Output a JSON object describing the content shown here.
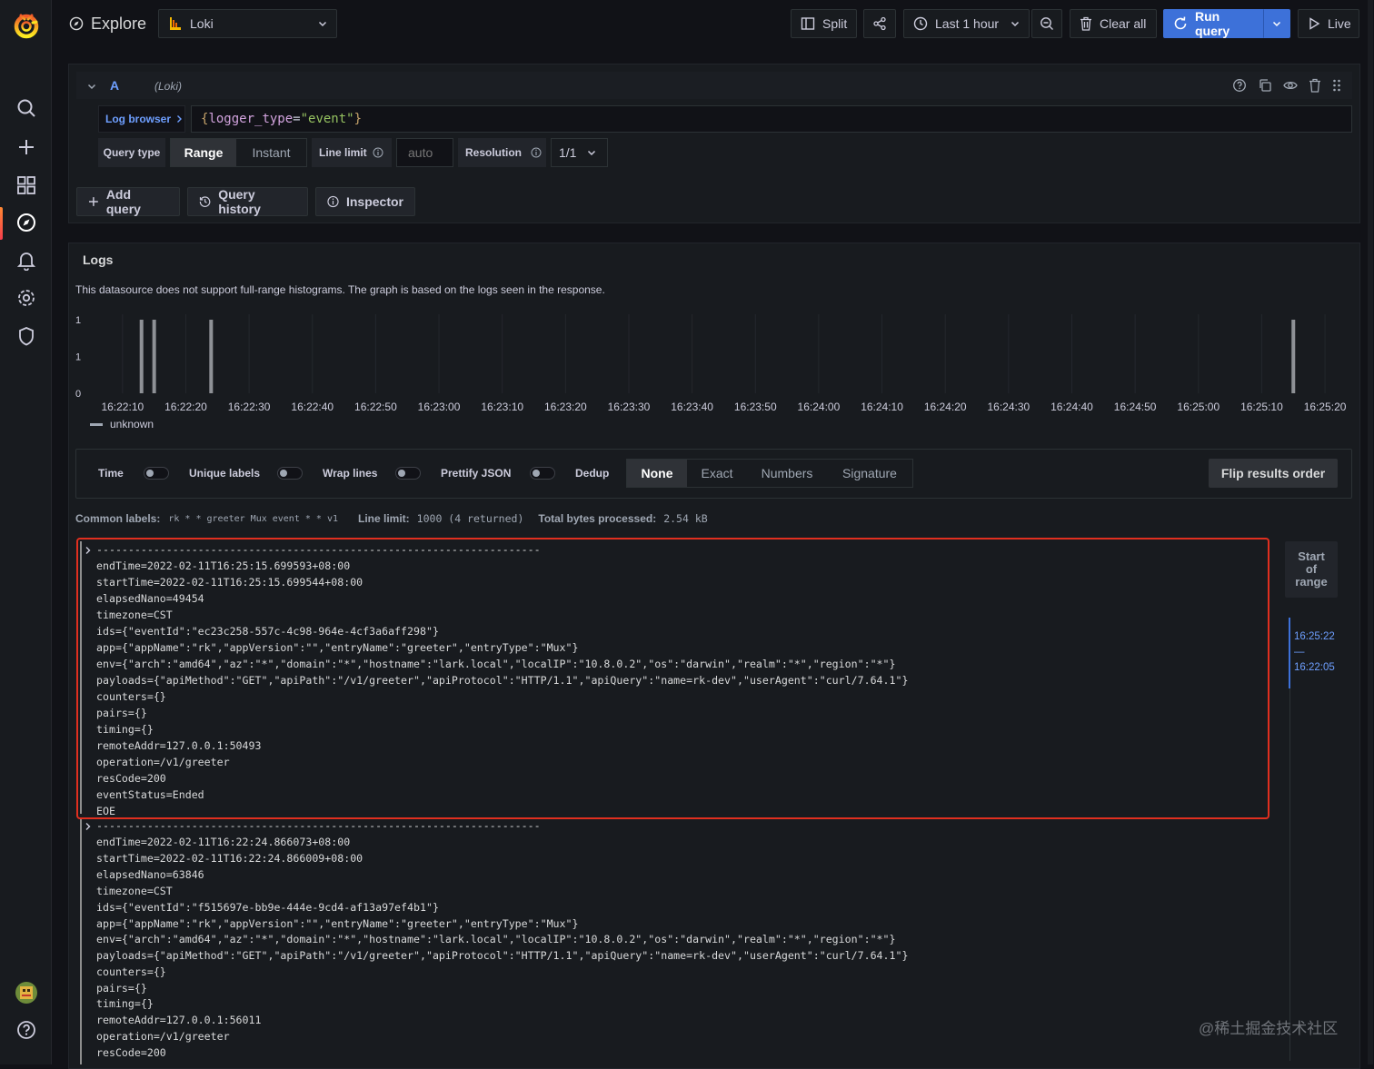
{
  "app": {
    "title": "Explore"
  },
  "datasource": {
    "name": "Loki"
  },
  "toolbar": {
    "split": "Split",
    "time_range": "Last 1 hour",
    "clear_all": "Clear all",
    "run_query": "Run query",
    "live": "Live"
  },
  "query": {
    "ref_id": "A",
    "datasource_label": "(Loki)",
    "log_browser": "Log browser",
    "expr": {
      "open": "{",
      "key": "logger_type",
      "eq": "=",
      "value": "\"event\"",
      "close": "}"
    },
    "query_type_label": "Query type",
    "types": [
      "Range",
      "Instant"
    ],
    "selected_type": "Range",
    "line_limit_label": "Line limit",
    "line_limit_placeholder": "auto",
    "resolution_label": "Resolution",
    "resolution_value": "1/1"
  },
  "actions": {
    "add_query": "Add query",
    "query_history": "Query history",
    "inspector": "Inspector"
  },
  "logs": {
    "title": "Logs",
    "info": "This datasource does not support full-range histograms. The graph is based on the logs seen in the response.",
    "legend": "unknown",
    "options": {
      "time": "Time",
      "unique_labels": "Unique labels",
      "wrap_lines": "Wrap lines",
      "prettify_json": "Prettify JSON",
      "dedup": "Dedup",
      "dedup_modes": [
        "None",
        "Exact",
        "Numbers",
        "Signature"
      ],
      "dedup_selected": "None",
      "flip": "Flip results order"
    },
    "meta": {
      "common_labels_label": "Common labels:",
      "common_labels_value": "rk * * greeter Mux event * * v1",
      "line_limit_label": "Line limit:",
      "line_limit_value": "1000 (4 returned)",
      "total_bytes_label": "Total bytes processed:",
      "total_bytes_value": "2.54 kB"
    },
    "entries": [
      {
        "lines": [
          "----------------------------------------------------------------------",
          "endTime=2022-02-11T16:25:15.699593+08:00",
          "startTime=2022-02-11T16:25:15.699544+08:00",
          "elapsedNano=49454",
          "timezone=CST",
          "ids={\"eventId\":\"ec23c258-557c-4c98-964e-4cf3a6aff298\"}",
          "app={\"appName\":\"rk\",\"appVersion\":\"\",\"entryName\":\"greeter\",\"entryType\":\"Mux\"}",
          "env={\"arch\":\"amd64\",\"az\":\"*\",\"domain\":\"*\",\"hostname\":\"lark.local\",\"localIP\":\"10.8.0.2\",\"os\":\"darwin\",\"realm\":\"*\",\"region\":\"*\"}",
          "payloads={\"apiMethod\":\"GET\",\"apiPath\":\"/v1/greeter\",\"apiProtocol\":\"HTTP/1.1\",\"apiQuery\":\"name=rk-dev\",\"userAgent\":\"curl/7.64.1\"}",
          "counters={}",
          "pairs={}",
          "timing={}",
          "remoteAddr=127.0.0.1:50493",
          "operation=/v1/greeter",
          "resCode=200",
          "eventStatus=Ended",
          "EOE"
        ]
      },
      {
        "lines": [
          "----------------------------------------------------------------------",
          "endTime=2022-02-11T16:22:24.866073+08:00",
          "startTime=2022-02-11T16:22:24.866009+08:00",
          "elapsedNano=63846",
          "timezone=CST",
          "ids={\"eventId\":\"f515697e-bb9e-444e-9cd4-af13a97ef4b1\"}",
          "app={\"appName\":\"rk\",\"appVersion\":\"\",\"entryName\":\"greeter\",\"entryType\":\"Mux\"}",
          "env={\"arch\":\"amd64\",\"az\":\"*\",\"domain\":\"*\",\"hostname\":\"lark.local\",\"localIP\":\"10.8.0.2\",\"os\":\"darwin\",\"realm\":\"*\",\"region\":\"*\"}",
          "payloads={\"apiMethod\":\"GET\",\"apiPath\":\"/v1/greeter\",\"apiProtocol\":\"HTTP/1.1\",\"apiQuery\":\"name=rk-dev\",\"userAgent\":\"curl/7.64.1\"}",
          "counters={}",
          "pairs={}",
          "timing={}",
          "remoteAddr=127.0.0.1:56011",
          "operation=/v1/greeter",
          "resCode=200"
        ]
      }
    ],
    "navigator": {
      "start_label": [
        "Start",
        "of",
        "range"
      ],
      "range_end": "16:25:22",
      "range_sep": "—",
      "range_start": "16:22:05"
    }
  },
  "chart_data": {
    "type": "bar",
    "ytick_labels": [
      "1",
      "1",
      "0"
    ],
    "ylim": [
      0,
      1
    ],
    "xtick_labels": [
      "16:22:10",
      "16:22:20",
      "16:22:30",
      "16:22:40",
      "16:22:50",
      "16:23:00",
      "16:23:10",
      "16:23:20",
      "16:23:30",
      "16:23:40",
      "16:23:50",
      "16:24:00",
      "16:24:10",
      "16:24:20",
      "16:24:30",
      "16:24:40",
      "16:24:50",
      "16:25:00",
      "16:25:10",
      "16:25:20"
    ],
    "x_start": "16:22:05",
    "x_end": "16:25:22",
    "series": [
      {
        "name": "unknown",
        "x": [
          "16:22:13",
          "16:22:15",
          "16:22:24",
          "16:25:15"
        ],
        "values": [
          1,
          1,
          1,
          1
        ]
      }
    ]
  },
  "watermark": "@稀土掘金技术社区",
  "colors": {
    "accent": "#3d71d9",
    "highlight": "#e02f1f",
    "brand": "#f46800",
    "query_value": "#95c160",
    "query_key": "#d2a3de"
  }
}
